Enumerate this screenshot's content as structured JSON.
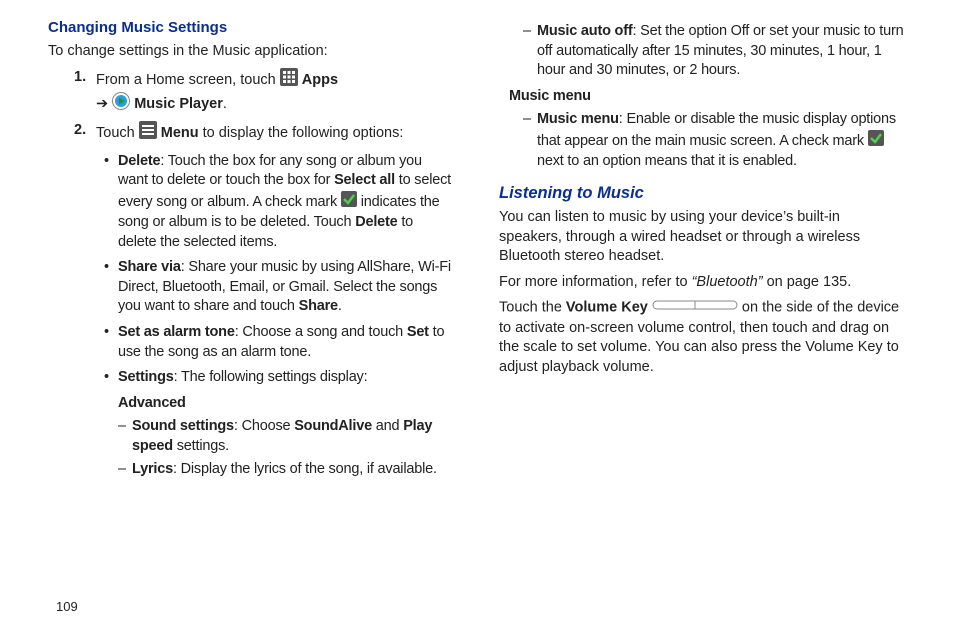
{
  "left": {
    "heading": "Changing Music Settings",
    "intro": "To change settings in the Music application:",
    "step1_num": "1.",
    "step1_a": "From a Home screen, touch ",
    "step1_apps": " Apps",
    "step1_arrow": "➔ ",
    "step1_mp": " Music Player",
    "step1_period": ".",
    "step2_num": "2.",
    "step2_a": "Touch ",
    "step2_menu": " Menu",
    "step2_b": " to display the following options:",
    "bullets": {
      "delete_label": "Delete",
      "delete_a": ": Touch the box for any song or album you want to delete or touch the box for ",
      "delete_selectall": "Select all",
      "delete_b": " to select every song or album. A check mark ",
      "delete_c": " indicates the song or album is to be deleted. Touch ",
      "delete_d": "Delete",
      "delete_e": " to delete the selected items.",
      "share_label": "Share via",
      "share_a": ": Share your music by using AllShare, Wi-Fi Direct, Bluetooth, Email, or Gmail. Select the songs you want to share and touch ",
      "share_b": "Share",
      "share_c": ".",
      "alarm_label": "Set as alarm tone",
      "alarm_a": ": Choose a song and touch ",
      "alarm_b": "Set",
      "alarm_c": " to use the song as an alarm tone.",
      "settings_label": "Settings",
      "settings_a": ": The following settings display:"
    },
    "advanced_head": "Advanced",
    "dash": {
      "sound_label": "Sound settings",
      "sound_a": ": Choose ",
      "sound_b": "SoundAlive",
      "sound_c": " and ",
      "sound_d": "Play speed",
      "sound_e": " settings.",
      "lyrics_label": "Lyrics",
      "lyrics_a": ": Display the lyrics of the song, if available."
    }
  },
  "right": {
    "dash_top": {
      "auto_label": "Music auto off",
      "auto_a": ": Set the option Off or set your music to turn off automatically after 15 minutes, 30 minutes, 1 hour, 1 hour and 30 minutes, or 2 hours."
    },
    "music_menu_head": "Music menu",
    "dash_menu": {
      "mm_label": "Music menu",
      "mm_a": ": Enable or disable the music display options that appear on the main music screen. A check mark ",
      "mm_b": " next to an option means that it is enabled."
    },
    "listening_head": "Listening to Music",
    "listen_p1": "You can listen to music by using your device’s built-in speakers, through a wired headset or through a wireless Bluetooth stereo headset.",
    "listen_p2a": "For more information, refer to ",
    "listen_p2quote": "“Bluetooth” ",
    "listen_p2b": " on page 135.",
    "listen_p3a": "Touch the ",
    "listen_p3vol": "Volume Key",
    "listen_p3b": " on the side of the device to activate on-screen volume control, then touch and drag on the scale to set volume. You can also press the Volume Key to adjust playback volume."
  },
  "page_number": "109"
}
